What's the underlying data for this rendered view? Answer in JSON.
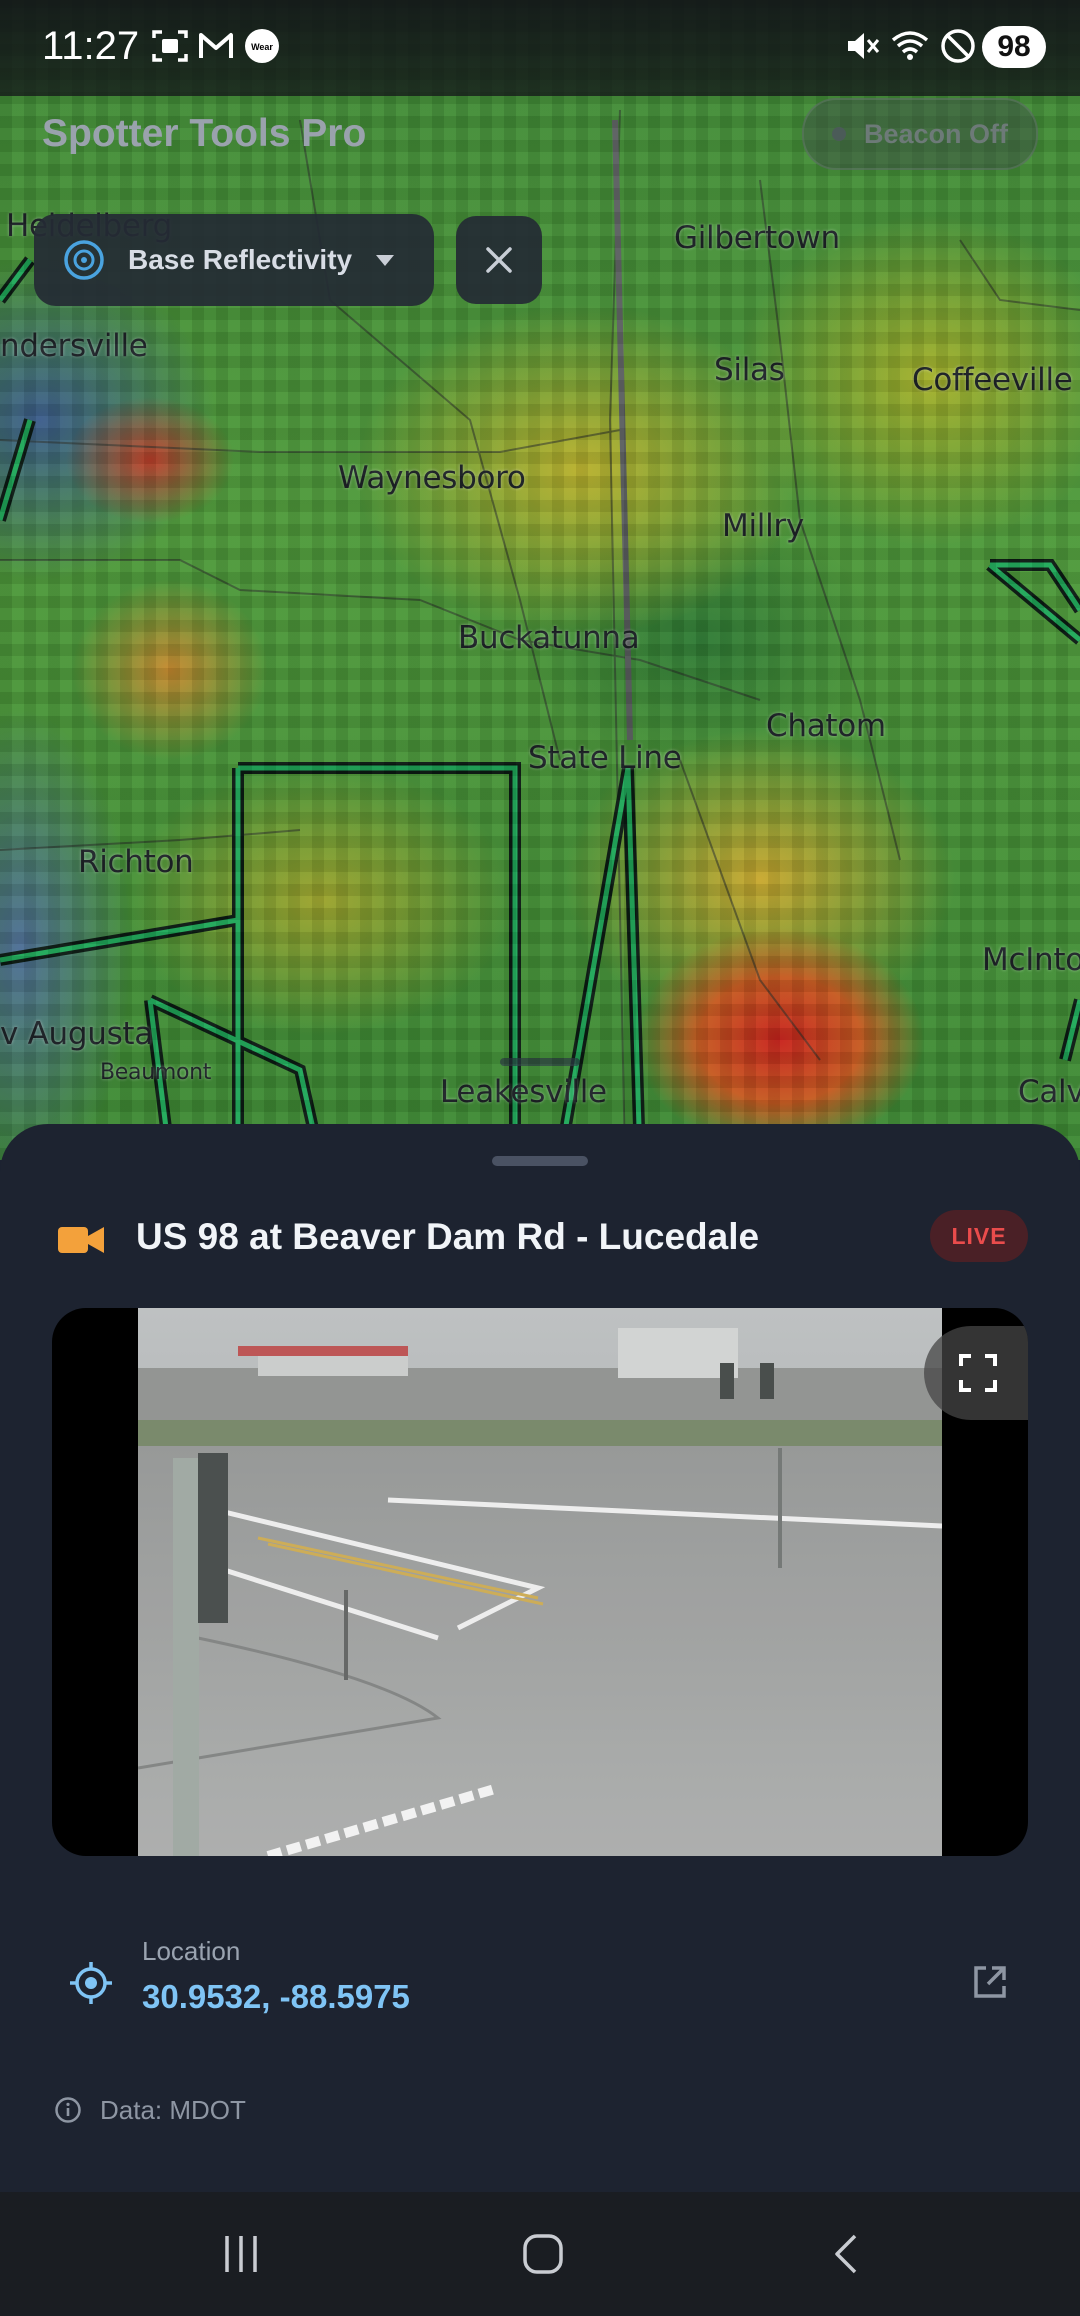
{
  "status_bar": {
    "time": "11:27",
    "battery": "98",
    "left_icons": [
      "screenshot-icon",
      "gmail-icon",
      "wear-os-icon"
    ],
    "right_icons": [
      "mute-icon",
      "wifi-6-icon",
      "do-not-disturb-icon"
    ],
    "wear_label": "Wear"
  },
  "app": {
    "title": "Spotter Tools Pro",
    "beacon_label": "Beacon Off"
  },
  "layer": {
    "selected": "Base Reflectivity",
    "icon": "radar-icon"
  },
  "map": {
    "places": [
      {
        "name": "Heidelberg",
        "size": "normal"
      },
      {
        "name": "Gilbertown",
        "size": "normal"
      },
      {
        "name": "ndersville",
        "size": "normal"
      },
      {
        "name": "Silas",
        "size": "normal"
      },
      {
        "name": "Coffeeville",
        "size": "normal"
      },
      {
        "name": "Waynesboro",
        "size": "normal"
      },
      {
        "name": "Millry",
        "size": "normal"
      },
      {
        "name": "Buckatunna",
        "size": "normal"
      },
      {
        "name": "Chatom",
        "size": "normal"
      },
      {
        "name": "State Line",
        "size": "normal"
      },
      {
        "name": "Richton",
        "size": "normal"
      },
      {
        "name": "McInto",
        "size": "normal"
      },
      {
        "name": "v Augusta",
        "size": "normal"
      },
      {
        "name": "Beaumont",
        "size": "small"
      },
      {
        "name": "Leakesville",
        "size": "normal"
      },
      {
        "name": "Calv",
        "size": "normal"
      }
    ]
  },
  "sheet": {
    "camera_title": "US 98 at Beaver Dam Rd - Lucedale",
    "live_badge": "LIVE",
    "location_label": "Location",
    "coordinates": "30.9532, -88.5975",
    "data_source": "Data: MDOT"
  },
  "colors": {
    "accent_blue": "#7fc4f5",
    "live_red": "#ea4c4c",
    "camera_orange": "#f3a13b",
    "sheet_bg": "#1d2330"
  }
}
